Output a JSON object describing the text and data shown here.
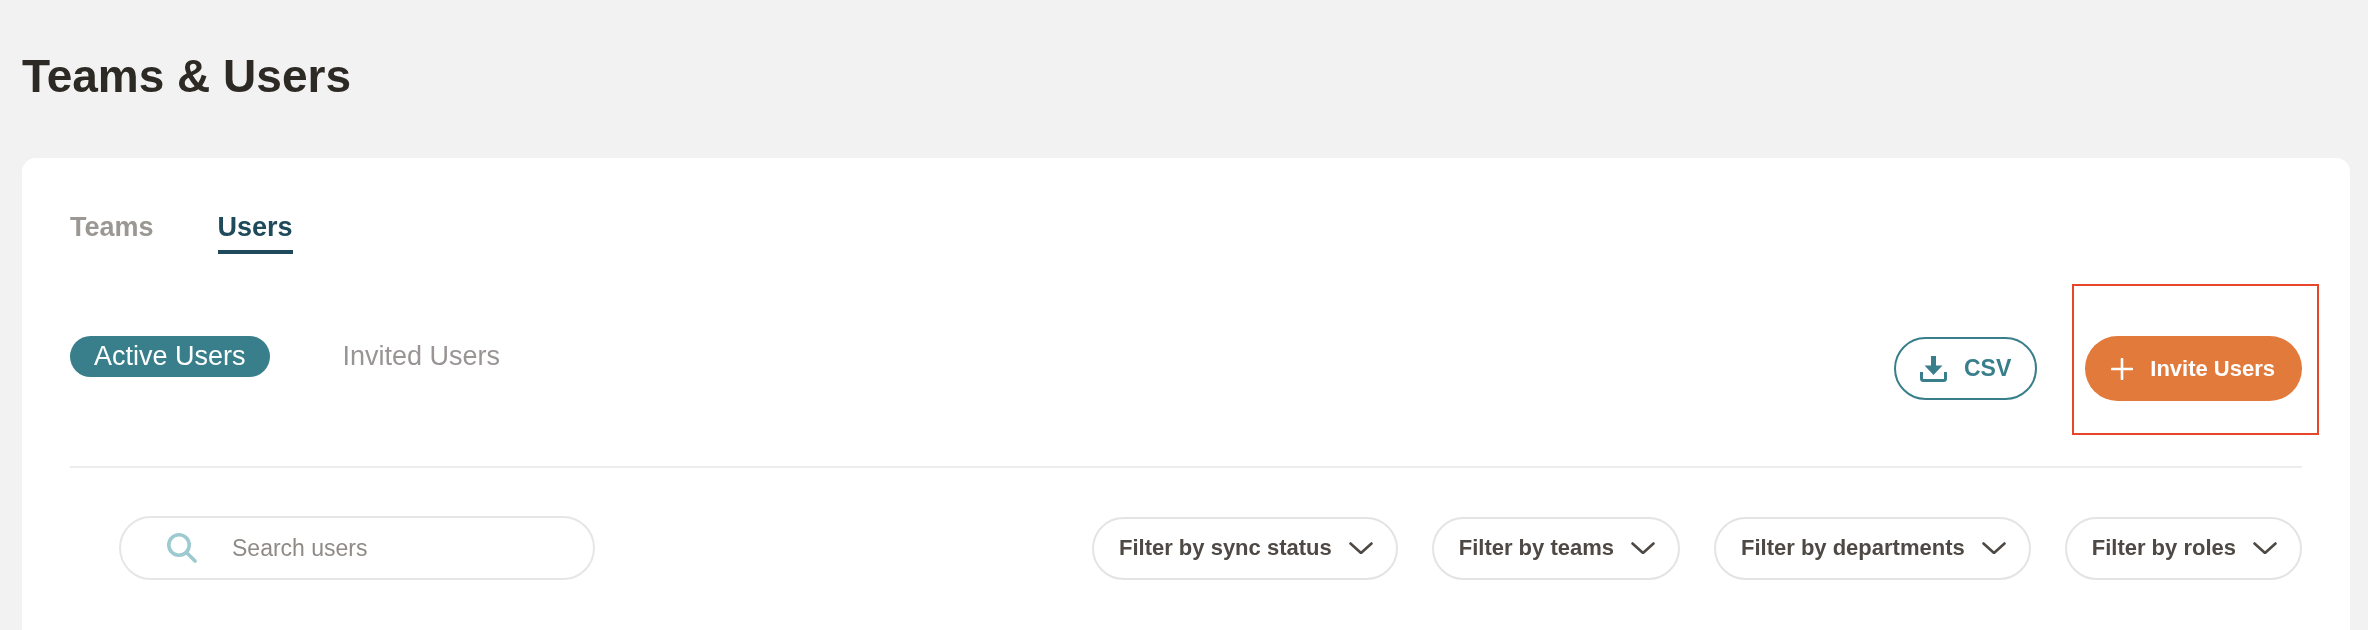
{
  "page": {
    "title": "Teams & Users"
  },
  "tabs": [
    {
      "label": "Teams",
      "selected": false
    },
    {
      "label": "Users",
      "selected": true
    }
  ],
  "user_tabs": [
    {
      "label": "Active Users",
      "selected": true
    },
    {
      "label": "Invited Users",
      "selected": false
    }
  ],
  "actions": [
    {
      "kind": "download",
      "label": "CSV",
      "highlighted": false
    },
    {
      "kind": "create",
      "label": "Invite Users",
      "highlighted": true
    }
  ],
  "search": {
    "placeholder": "Search users"
  },
  "filters": [
    {
      "label": "Filter by sync status"
    },
    {
      "label": "Filter by teams"
    },
    {
      "label": "Filter by departments"
    },
    {
      "label": "Filter by roles"
    }
  ]
}
